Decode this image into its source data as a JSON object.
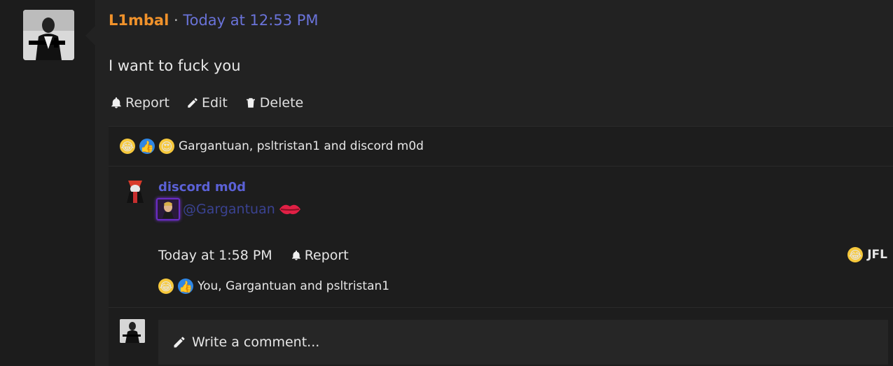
{
  "post": {
    "username": "L1mbal",
    "separator": "·",
    "timestamp": "Today at 12:53 PM",
    "body": "I want to fuck you",
    "actions": {
      "report": "Report",
      "edit": "Edit",
      "delete": "Delete"
    },
    "reactions_summary": "Gargantuan, psltristan1 and discord m0d"
  },
  "reply": {
    "username": "discord m0d",
    "mention": "@Gargantuan",
    "timestamp": "Today at 1:58 PM",
    "report": "Report",
    "reaction_user": "JFL",
    "reactions_summary": "You, Gargantuan and psltristan1"
  },
  "comment": {
    "placeholder": "Write a comment..."
  },
  "colors": {
    "username": "#f0922b",
    "timestamp": "#6a73d9",
    "reply_name": "#5b61d6"
  }
}
